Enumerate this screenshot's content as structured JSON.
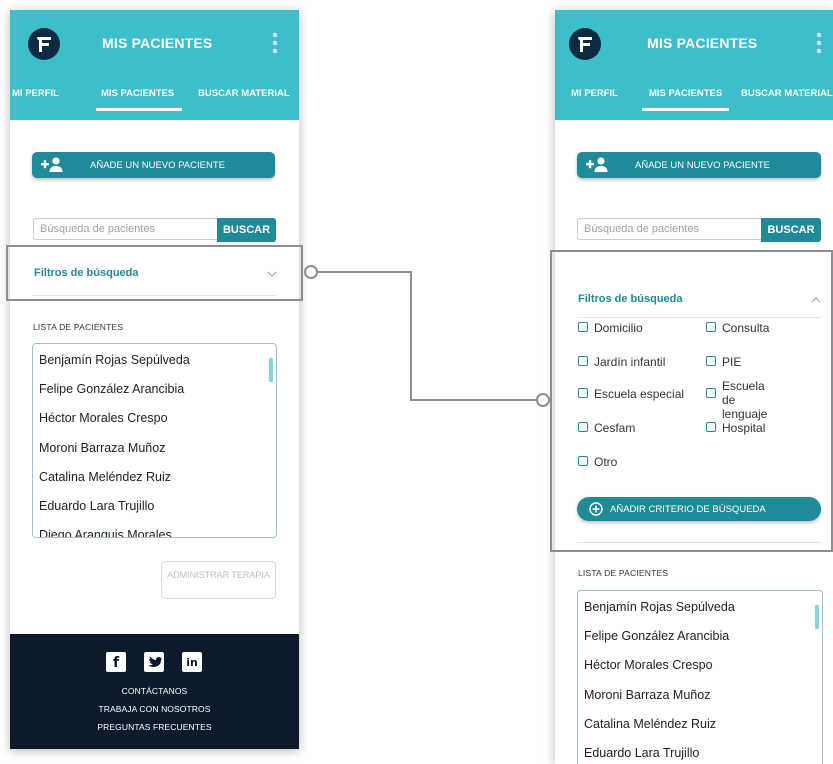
{
  "app": {
    "title": "MIS PACIENTES",
    "tabs": [
      "MI PERFIL",
      "MIS PACIENTES",
      "BUSCAR MATERIAL"
    ],
    "active_tab": "MIS PACIENTES"
  },
  "add_patient_label": "AÑADE UN NUEVO PACIENTE",
  "search": {
    "placeholder": "Búsqueda de pacientes",
    "button": "BUSCAR"
  },
  "filters": {
    "title": "Filtros de búsqueda",
    "options": [
      "Domicilio",
      "Consulta",
      "Jardín infantil",
      "PIE",
      "Escuela especial",
      "Escuela de lenguaje",
      "Cesfam",
      "Hospital",
      "Otro"
    ],
    "add_criteria": "AÑADIR CRITERIO DE BÚSQUEDA"
  },
  "patient_list": {
    "title": "LISTA DE PACIENTES",
    "items": [
      "Benjamín Rojas Sepúlveda",
      "Felipe González Arancibia",
      "Héctor Morales Crespo",
      "Moroni Barraza Muñoz",
      "Catalina Meléndez Ruiz",
      "Eduardo Lara Trujillo",
      "Diego Aranguis Morales"
    ]
  },
  "admin_button": "ADMINISTRAR TERAPIA",
  "footer": {
    "social": [
      "facebook",
      "twitter",
      "linkedin"
    ],
    "links": [
      "CONTÁCTANOS",
      "TRABAJA CON NOSOTROS",
      "PREGUNTAS FRECUENTES"
    ]
  },
  "colors": {
    "header": "#3cbecb",
    "primary": "#1f8a98",
    "footer": "#0c1a2c",
    "callout": "#8a8f91"
  }
}
